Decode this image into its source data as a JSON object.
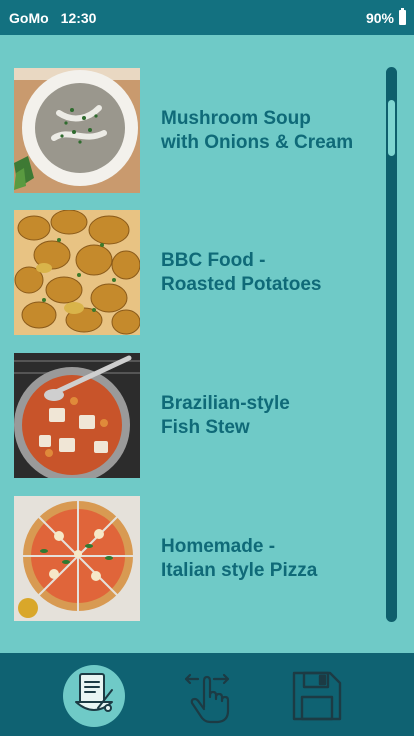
{
  "status_bar": {
    "carrier": "GoMo",
    "time": "12:30",
    "battery": "90%",
    "battery_level": 0.9
  },
  "recipes": [
    {
      "title": "Mushroom Soup\nwith Onions & Cream",
      "image": "mushroom-soup-photo"
    },
    {
      "title": "BBC Food -\nRoasted Potatoes",
      "image": "roasted-potatoes-photo"
    },
    {
      "title": "Brazilian-style\nFish Stew",
      "image": "fish-stew-photo"
    },
    {
      "title": "Homemade -\nItalian style Pizza",
      "image": "pizza-photo"
    }
  ],
  "bottom_nav": [
    {
      "icon": "recipe-book-icon",
      "active": true
    },
    {
      "icon": "swipe-gesture-icon",
      "active": false
    },
    {
      "icon": "save-floppy-icon",
      "active": false
    }
  ],
  "colors": {
    "background": "#6fcac7",
    "status_bar": "#137180",
    "title_text": "#0f6a78",
    "bottom_bar": "#0f6272",
    "scrollbar": "#0e5f6c",
    "scroll_thumb": "#7fd6d1"
  }
}
